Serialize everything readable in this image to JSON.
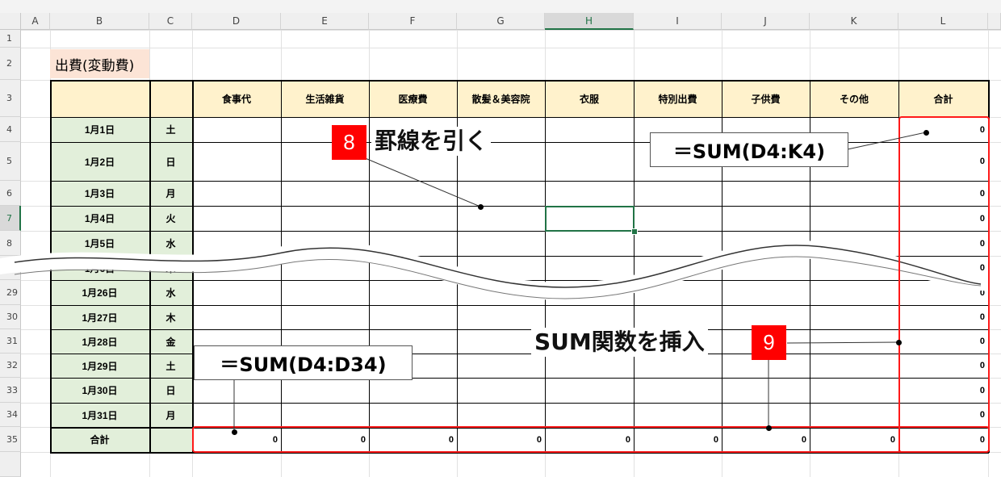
{
  "columns": [
    "A",
    "B",
    "C",
    "D",
    "E",
    "F",
    "G",
    "H",
    "I",
    "J",
    "K",
    "L"
  ],
  "selected_column": "H",
  "row_numbers": [
    "1",
    "2",
    "3",
    "4",
    "5",
    "6",
    "7",
    "8",
    "9",
    "29",
    "30",
    "31",
    "32",
    "33",
    "34",
    "35"
  ],
  "selected_row": "7",
  "sheet": {
    "title": "出費(変動費)",
    "categories": [
      "食事代",
      "生活雑貨",
      "医療費",
      "散髪＆美容院",
      "衣服",
      "特別出費",
      "子供費",
      "その他",
      "合計"
    ],
    "dates": [
      {
        "date": "1月1日",
        "day": "土"
      },
      {
        "date": "1月2日",
        "day": "日"
      },
      {
        "date": "1月3日",
        "day": "月"
      },
      {
        "date": "1月4日",
        "day": "火"
      },
      {
        "date": "1月5日",
        "day": "水"
      },
      {
        "date": "1月6日",
        "day": "木"
      },
      {
        "date": "1月26日",
        "day": "水"
      },
      {
        "date": "1月27日",
        "day": "木"
      },
      {
        "date": "1月28日",
        "day": "金"
      },
      {
        "date": "1月29日",
        "day": "土"
      },
      {
        "date": "1月30日",
        "day": "日"
      },
      {
        "date": "1月31日",
        "day": "月"
      }
    ],
    "row_totals": [
      "0",
      "0",
      "0",
      "0",
      "0",
      "0",
      "0",
      "0",
      "0",
      "0",
      "0",
      "0"
    ],
    "total_label": "合計",
    "column_totals": [
      "0",
      "0",
      "0",
      "0",
      "0",
      "0",
      "0",
      "0",
      "0"
    ]
  },
  "annotations": {
    "step8_number": "8",
    "step8_text": "罫線を引く",
    "formula_row": "＝SUM(D4:K4)",
    "step9_number": "9",
    "step9_text": "SUM関数を挿入",
    "formula_col": "＝SUM(D4:D34)"
  },
  "colors": {
    "header_fill": "#fff2cc",
    "date_fill": "#e2efda",
    "title_fill": "#fce4d6",
    "highlight_red": "#ff0000",
    "excel_green": "#217346"
  }
}
